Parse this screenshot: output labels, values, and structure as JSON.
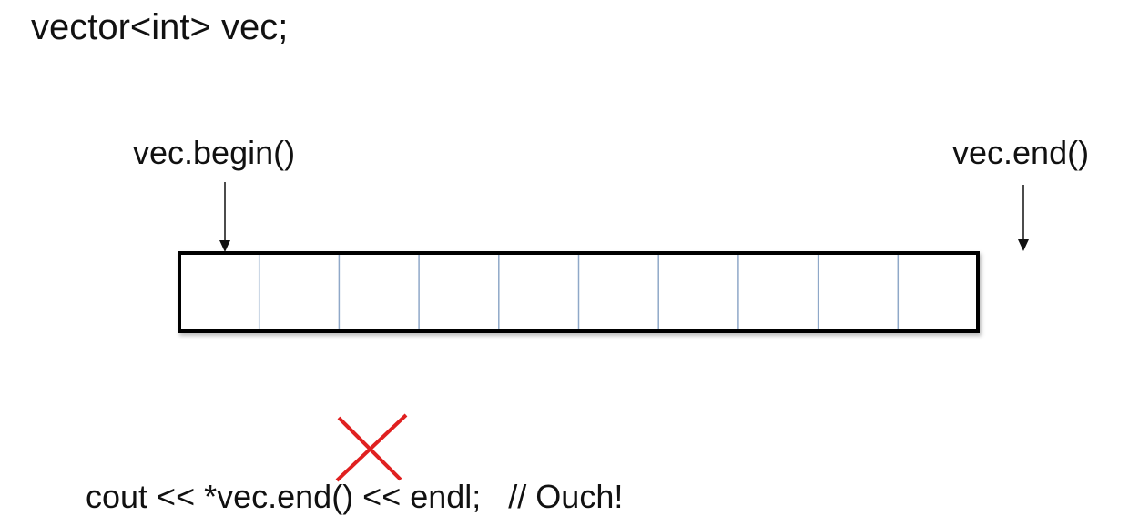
{
  "title": "vector<int> vec;",
  "pointers": {
    "begin_label": "vec.begin()",
    "end_label": "vec.end()"
  },
  "vector": {
    "cell_count": 10
  },
  "code_line": {
    "text": "cout << *vec.end() << endl;   // Ouch!"
  },
  "colors": {
    "text": "#111111",
    "outline": "#000000",
    "divider": "#8FA8C8",
    "cross": "#E02020"
  }
}
